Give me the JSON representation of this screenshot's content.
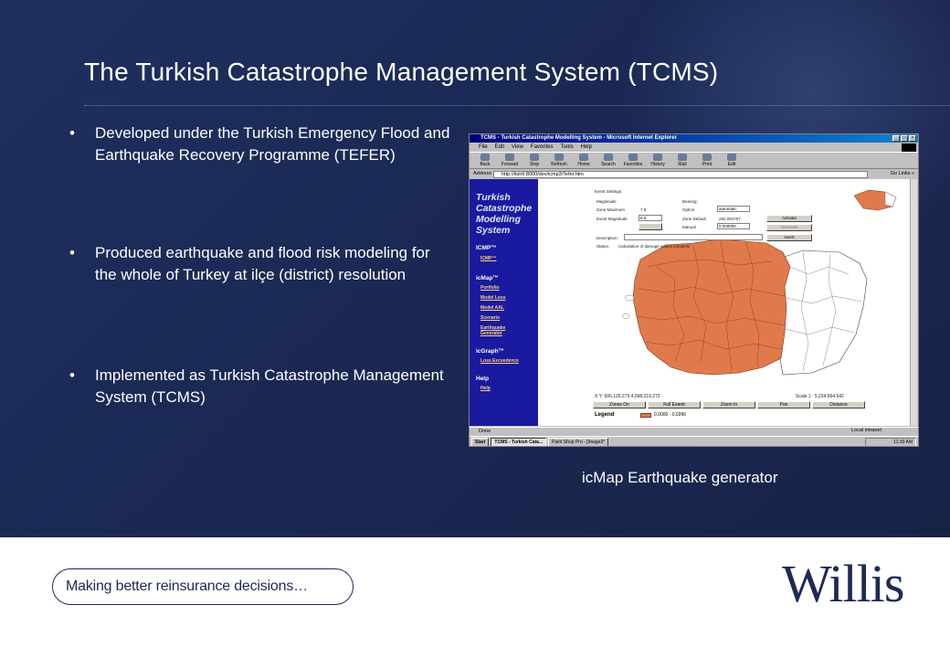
{
  "slide": {
    "title": "The Turkish Catastrophe Management System (TCMS)",
    "bullets": [
      "Developed under the Turkish Emergency Flood and Earthquake Recovery Programme (TEFER)",
      "Produced earthquake and flood risk modeling for the whole of Turkey at ilçe (district) resolution",
      "Implemented as Turkish Catastrophe Management System (TCMS)"
    ],
    "bullet_glyph": "•",
    "caption": "icMap Earthquake generator",
    "tagline": "Making better reinsurance decisions…",
    "logo": "Willis",
    "colors": {
      "background": "#1b2955",
      "accent": "#e07a4a",
      "navy": "#1c2a55"
    }
  },
  "screenshot": {
    "window_title": "TCMS - Turkish Catastrophe Modelling System - Microsoft Internet Explorer",
    "window_buttons": [
      "_",
      "□",
      "×"
    ],
    "menu": [
      "File",
      "Edit",
      "View",
      "Favorites",
      "Tools",
      "Help"
    ],
    "toolbar": [
      "Back",
      "Forward",
      "Stop",
      "Refresh",
      "Home",
      "Search",
      "Favorites",
      "History",
      "Mail",
      "Print",
      "Edit"
    ],
    "address_label": "Address",
    "address_value": "http://itsh6:8000/dev/icmp3/Tefer.htm",
    "address_right": "Go  Links »",
    "nav": {
      "title": "Turkish Catastrophe Modelling System",
      "sections": [
        {
          "label": "ICMP™",
          "links": [
            "ICMP™"
          ]
        },
        {
          "label": "icMap™",
          "links": [
            "Portfolio",
            "Model Loss",
            "Model AAL",
            "Scenario",
            "Earthquake Generator"
          ]
        },
        {
          "label": "icGraph™",
          "links": [
            "Loss Exceedence"
          ]
        },
        {
          "label": "Help",
          "links": [
            "Help"
          ]
        }
      ]
    },
    "form": {
      "heading": "Event Settings:",
      "magnitude_label": "Magnitude:",
      "zone_max_label": "Zone Maximum",
      "zone_max_value": "7.8",
      "event_mag_label": "Event Magnitude",
      "event_mag_value": "6.0",
      "bearing_label": "Bearing:",
      "option_label": "Option",
      "option_value": "automatic",
      "zone_default_label": "Zone Default",
      "zone_default_value": "282.094757",
      "manual_label": "Manual",
      "manual_value": "0.000000",
      "activate_label": "Activate",
      "generate_label": "Generate",
      "insert_label": "Insert",
      "description_label": "Description:",
      "status_label": "Status:",
      "status_value": "Calculation of damage values complete"
    },
    "coords": {
      "xy": "X Y: 606,126.279    4,598,219.272",
      "scale": "Scale 1 :       5,234,564.542"
    },
    "map_tools": [
      "Zones On",
      "Full Extent",
      "Zoom In",
      "Pan",
      "Distance"
    ],
    "legend_label": "Legend",
    "legend_range": "0.0000 - 0.0266",
    "status_text": "Done",
    "status_zone": "Local intranet",
    "taskbar": [
      "Start",
      "TCMS - Turkish Cata...",
      "Paint Shop Pro - [Image3*"
    ],
    "clock": "11:30 AM"
  }
}
